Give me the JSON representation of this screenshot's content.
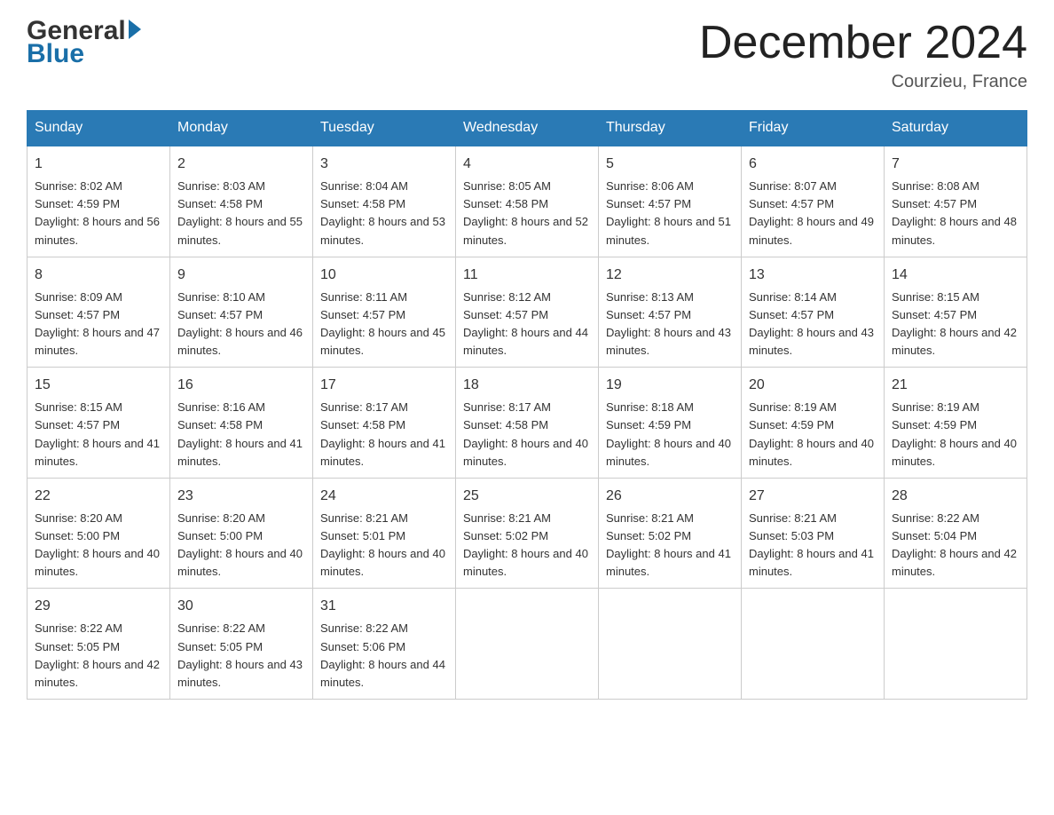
{
  "header": {
    "logo_general": "General",
    "logo_blue": "Blue",
    "month_title": "December 2024",
    "location": "Courzieu, France"
  },
  "calendar": {
    "days_of_week": [
      "Sunday",
      "Monday",
      "Tuesday",
      "Wednesday",
      "Thursday",
      "Friday",
      "Saturday"
    ],
    "weeks": [
      [
        {
          "day": "1",
          "sunrise": "8:02 AM",
          "sunset": "4:59 PM",
          "daylight": "8 hours and 56 minutes."
        },
        {
          "day": "2",
          "sunrise": "8:03 AM",
          "sunset": "4:58 PM",
          "daylight": "8 hours and 55 minutes."
        },
        {
          "day": "3",
          "sunrise": "8:04 AM",
          "sunset": "4:58 PM",
          "daylight": "8 hours and 53 minutes."
        },
        {
          "day": "4",
          "sunrise": "8:05 AM",
          "sunset": "4:58 PM",
          "daylight": "8 hours and 52 minutes."
        },
        {
          "day": "5",
          "sunrise": "8:06 AM",
          "sunset": "4:57 PM",
          "daylight": "8 hours and 51 minutes."
        },
        {
          "day": "6",
          "sunrise": "8:07 AM",
          "sunset": "4:57 PM",
          "daylight": "8 hours and 49 minutes."
        },
        {
          "day": "7",
          "sunrise": "8:08 AM",
          "sunset": "4:57 PM",
          "daylight": "8 hours and 48 minutes."
        }
      ],
      [
        {
          "day": "8",
          "sunrise": "8:09 AM",
          "sunset": "4:57 PM",
          "daylight": "8 hours and 47 minutes."
        },
        {
          "day": "9",
          "sunrise": "8:10 AM",
          "sunset": "4:57 PM",
          "daylight": "8 hours and 46 minutes."
        },
        {
          "day": "10",
          "sunrise": "8:11 AM",
          "sunset": "4:57 PM",
          "daylight": "8 hours and 45 minutes."
        },
        {
          "day": "11",
          "sunrise": "8:12 AM",
          "sunset": "4:57 PM",
          "daylight": "8 hours and 44 minutes."
        },
        {
          "day": "12",
          "sunrise": "8:13 AM",
          "sunset": "4:57 PM",
          "daylight": "8 hours and 43 minutes."
        },
        {
          "day": "13",
          "sunrise": "8:14 AM",
          "sunset": "4:57 PM",
          "daylight": "8 hours and 43 minutes."
        },
        {
          "day": "14",
          "sunrise": "8:15 AM",
          "sunset": "4:57 PM",
          "daylight": "8 hours and 42 minutes."
        }
      ],
      [
        {
          "day": "15",
          "sunrise": "8:15 AM",
          "sunset": "4:57 PM",
          "daylight": "8 hours and 41 minutes."
        },
        {
          "day": "16",
          "sunrise": "8:16 AM",
          "sunset": "4:58 PM",
          "daylight": "8 hours and 41 minutes."
        },
        {
          "day": "17",
          "sunrise": "8:17 AM",
          "sunset": "4:58 PM",
          "daylight": "8 hours and 41 minutes."
        },
        {
          "day": "18",
          "sunrise": "8:17 AM",
          "sunset": "4:58 PM",
          "daylight": "8 hours and 40 minutes."
        },
        {
          "day": "19",
          "sunrise": "8:18 AM",
          "sunset": "4:59 PM",
          "daylight": "8 hours and 40 minutes."
        },
        {
          "day": "20",
          "sunrise": "8:19 AM",
          "sunset": "4:59 PM",
          "daylight": "8 hours and 40 minutes."
        },
        {
          "day": "21",
          "sunrise": "8:19 AM",
          "sunset": "4:59 PM",
          "daylight": "8 hours and 40 minutes."
        }
      ],
      [
        {
          "day": "22",
          "sunrise": "8:20 AM",
          "sunset": "5:00 PM",
          "daylight": "8 hours and 40 minutes."
        },
        {
          "day": "23",
          "sunrise": "8:20 AM",
          "sunset": "5:00 PM",
          "daylight": "8 hours and 40 minutes."
        },
        {
          "day": "24",
          "sunrise": "8:21 AM",
          "sunset": "5:01 PM",
          "daylight": "8 hours and 40 minutes."
        },
        {
          "day": "25",
          "sunrise": "8:21 AM",
          "sunset": "5:02 PM",
          "daylight": "8 hours and 40 minutes."
        },
        {
          "day": "26",
          "sunrise": "8:21 AM",
          "sunset": "5:02 PM",
          "daylight": "8 hours and 41 minutes."
        },
        {
          "day": "27",
          "sunrise": "8:21 AM",
          "sunset": "5:03 PM",
          "daylight": "8 hours and 41 minutes."
        },
        {
          "day": "28",
          "sunrise": "8:22 AM",
          "sunset": "5:04 PM",
          "daylight": "8 hours and 42 minutes."
        }
      ],
      [
        {
          "day": "29",
          "sunrise": "8:22 AM",
          "sunset": "5:05 PM",
          "daylight": "8 hours and 42 minutes."
        },
        {
          "day": "30",
          "sunrise": "8:22 AM",
          "sunset": "5:05 PM",
          "daylight": "8 hours and 43 minutes."
        },
        {
          "day": "31",
          "sunrise": "8:22 AM",
          "sunset": "5:06 PM",
          "daylight": "8 hours and 44 minutes."
        },
        {
          "day": "",
          "sunrise": "",
          "sunset": "",
          "daylight": ""
        },
        {
          "day": "",
          "sunrise": "",
          "sunset": "",
          "daylight": ""
        },
        {
          "day": "",
          "sunrise": "",
          "sunset": "",
          "daylight": ""
        },
        {
          "day": "",
          "sunrise": "",
          "sunset": "",
          "daylight": ""
        }
      ]
    ]
  }
}
